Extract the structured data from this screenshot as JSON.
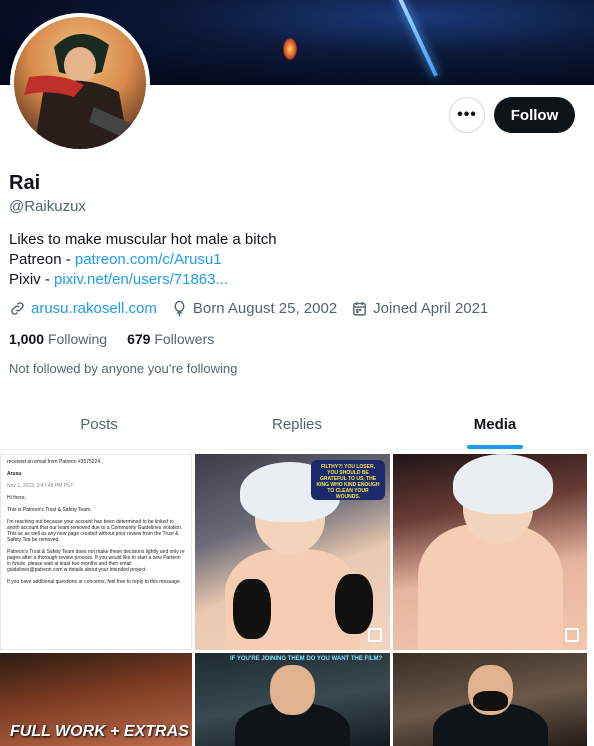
{
  "profile": {
    "name": "Rai",
    "handle": "@Raikuzux",
    "bio_line1": "Likes to make muscular hot male a bitch",
    "patreon_prefix": "Patreon - ",
    "patreon_link": "patreon.com/c/Arusu1",
    "pixiv_prefix": "Pixiv - ",
    "pixiv_link": "pixiv.net/en/users/71863...",
    "website": "arusu.rakosell.com",
    "born": "Born August 25, 2002",
    "joined": "Joined April 2021",
    "following_count": "1,000",
    "following_label": "Following",
    "followers_count": "679",
    "followers_label": "Followers",
    "not_followed": "Not followed by anyone you’re following"
  },
  "actions": {
    "more_label": "•••",
    "follow_label": "Follow"
  },
  "tabs": [
    {
      "label": "Posts"
    },
    {
      "label": "Replies"
    },
    {
      "label": "Media"
    }
  ],
  "media": {
    "email_lines": [
      "received an email from Patreon #3575224",
      "Arusu",
      "Nov 1, 2023, 3:47:48 PM PST",
      "Hi there,",
      "This is Patreon's Trust & Safety Team.",
      "I'm reaching out because your account has been determined to be linked to anoth account that our team removed due to a Community Guidelines violation. This ac as well as any new page created without prior review from the Trust & Safety Tea be removed.",
      "Patreon's Trust & Safety Team does not make these decisions lightly and only re pages after a thorough review process. If you would like to start a new Patreon in future, please wait at least two months and then email guidelines@patreon.com w details about your intended project.",
      "If you have additional questions or concerns, feel free to reply to this message."
    ],
    "bubble_text": "FILTHY?! YOU LOSER, YOU SHOULD BE GRATEFUL TO US, THE KING WHO KIND ENOUGH TO CLEAN YOUR WOUNDS.",
    "c4_text": "FULL WORK + EXTRAS",
    "c5_caption": "IF YOU'RE JOINING THEM DO YOU WANT THE FILM?"
  }
}
